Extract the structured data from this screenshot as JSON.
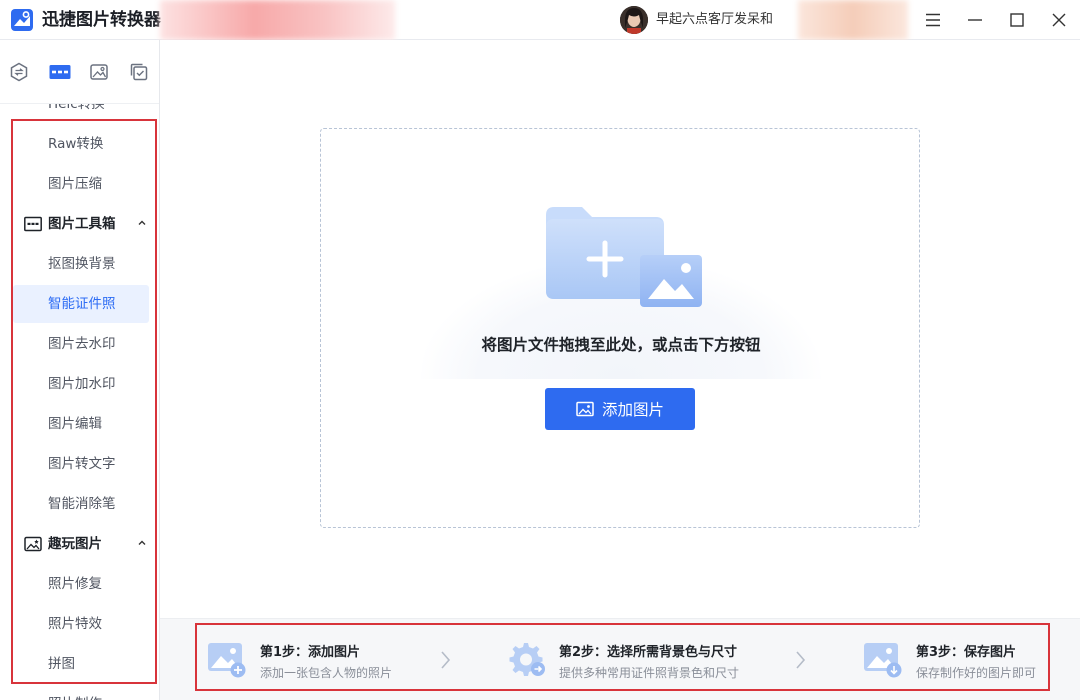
{
  "app": {
    "title": "迅捷图片转换器",
    "user_name": "早起六点客厅发呆和"
  },
  "sidebar": {
    "partial_top_item": "Heic转换",
    "items": [
      {
        "label": "Raw转换"
      },
      {
        "label": "图片压缩"
      }
    ],
    "groups": [
      {
        "label": "图片工具箱",
        "items": [
          "抠图换背景",
          "智能证件照",
          "图片去水印",
          "图片加水印",
          "图片编辑",
          "图片转文字",
          "智能消除笔"
        ]
      },
      {
        "label": "趣玩图片",
        "items": [
          "照片修复",
          "照片特效",
          "拼图"
        ]
      }
    ],
    "active_item": "智能证件照",
    "partial_bottom_item": "照片制作"
  },
  "main": {
    "drop_hint": "将图片文件拖拽至此处，或点击下方按钮",
    "add_button_label": "添加图片"
  },
  "steps": [
    {
      "title": "第1步：添加图片",
      "desc": "添加一张包含人物的照片"
    },
    {
      "title": "第2步：选择所需背景色与尺寸",
      "desc": "提供多种常用证件照背景色和尺寸"
    },
    {
      "title": "第3步：保存图片",
      "desc": "保存制作好的图片即可"
    }
  ],
  "colors": {
    "accent": "#2e6bf0",
    "highlight_box": "#d8343b",
    "active_bg": "#eaf1ff"
  },
  "icons": {
    "side_tabs": [
      "convert-icon",
      "toolbox-icon",
      "image-icon",
      "check-copy-icon"
    ],
    "window_controls": [
      "menu-icon",
      "minimize-icon",
      "maximize-icon",
      "close-icon"
    ]
  }
}
